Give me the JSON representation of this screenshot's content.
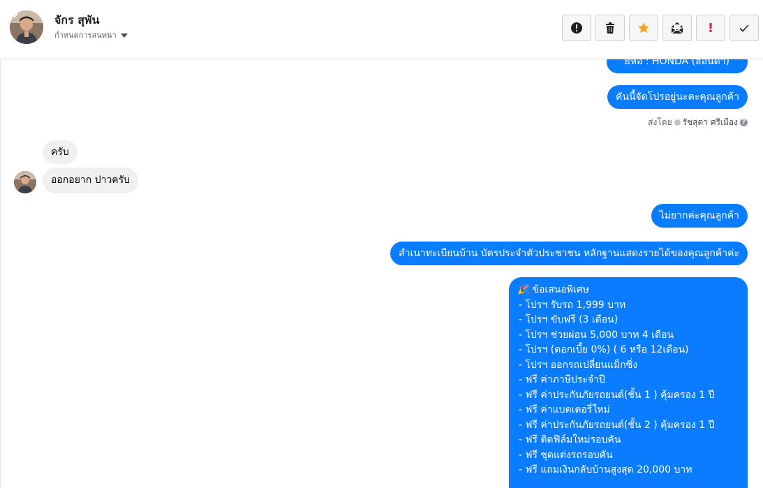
{
  "header": {
    "contact_name": "จักร สุพัน",
    "subtitle": "กำหนดการสนทนา",
    "toolbar": [
      {
        "name": "report-button",
        "icon": "alert-circle-icon"
      },
      {
        "name": "delete-button",
        "icon": "trash-icon"
      },
      {
        "name": "star-button",
        "icon": "star-icon"
      },
      {
        "name": "mark-unread-button",
        "icon": "envelope-open-icon"
      },
      {
        "name": "spam-button",
        "icon": "exclamation-icon",
        "label": "!"
      },
      {
        "name": "done-button",
        "icon": "check-icon"
      }
    ]
  },
  "messages": {
    "out_partial": "ยี่ห้อ : HONDA (ฮอนด้า)",
    "out_1": "คันนี้จัดโปรอยู่นะคะคุณลูกค้า",
    "seen_prefix": "ส่งโดย",
    "seen_agent": "รัชสุดา ศรีเมือง",
    "seen_help": "?",
    "in_1": "ครับ",
    "in_2": "ออกอยาก ปาวครับ",
    "out_2": "ไม่ยากค่ะคุณลูกค้า",
    "out_3": "สำเนาทะเบียนบ้าน บัตรประจำตัวประชาชน หลักฐานแสดงรายได้ของคุณลูกค้าค่ะ"
  },
  "promo": {
    "emoji": "🎉",
    "title": "ข้อเสนอพิเศษ",
    "lines": [
      "- โปรฯ รับรถ 1,999 บาท",
      "- โปรฯ ขับฟรี (3 เดือน)",
      "- โปรฯ ช่วยผ่อน 5,000 บาท 4 เดือน",
      "- โปรฯ (ดอกเบี้ย 0%) ( 6 หรือ 12เดือน)",
      "- โปรฯ ออกรถเปลี่ยนแม็กซิ่ง",
      "- ฟรี ค่าภาษีประจำปี",
      "- ฟรี ค่าประกันภัยรถยนต์(ชั้น 1 ) คุ้มครอง 1 ปี",
      "- ฟรี ค่าแบตเตอรี่ใหม่",
      "- ฟรี ค่าประกันภัยรถยนต์(ชั้น 2 ) คุ้มครอง 1 ปี",
      "- ฟรี ติดฟิล์มใหม่รอบคัน",
      "- ฟรี ชุดแต่งรถรอบคัน",
      "- ฟรี แถมเงินกลับบ้านสูงสุด 20,000 บาท"
    ]
  },
  "colors": {
    "bubble_out": "#0a7cff",
    "bubble_in": "#f0f0f0",
    "star": "#f5a623",
    "spam": "#e41e3f"
  }
}
